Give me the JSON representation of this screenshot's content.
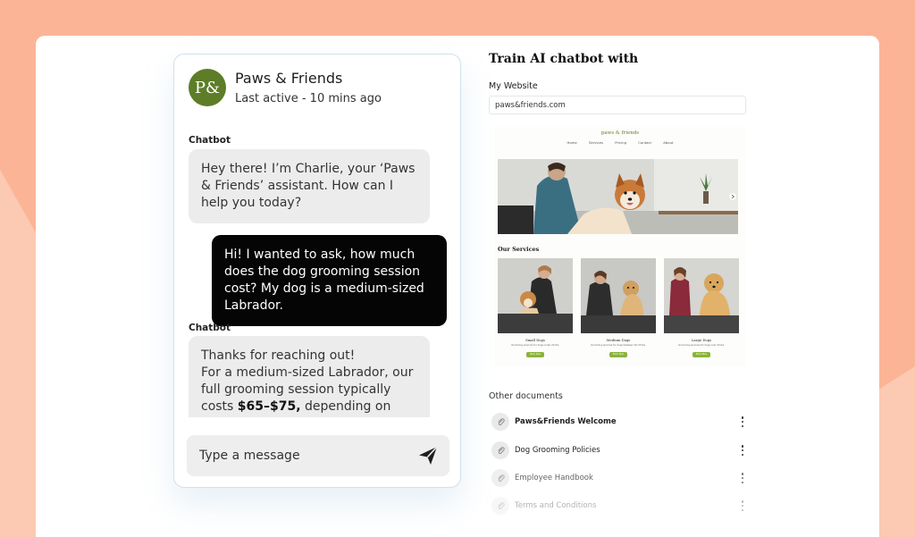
{
  "chat": {
    "avatar_text": "P&",
    "name": "Paws & Friends",
    "status": "Last active - 10 mins ago",
    "messages": [
      {
        "sender": "Chatbot",
        "text": "Hey there! I’m Charlie, your ‘Paws & Friends’ assistant. How can I help you today?"
      },
      {
        "sender": "",
        "text": "Hi! I wanted to ask, how much does the dog grooming session cost? My dog is a medium-sized Labrador."
      },
      {
        "sender": "Chatbot",
        "text_intro": "Thanks for reaching out!",
        "text_before": "For a medium-sized Labrador, our full grooming session typically costs ",
        "text_bold": "$65–$75,",
        "text_after": " depending on your pup's coat condition and any specific needs."
      }
    ],
    "composer_placeholder": "Type a message",
    "send_icon": "send-icon"
  },
  "train": {
    "title": "Train AI chatbot with",
    "website_label": "My Website",
    "website_value": "paws&friends.com",
    "preview": {
      "logo": "paws & friends",
      "nav": [
        "Home",
        "Services",
        "Pricing",
        "Contact",
        "About"
      ],
      "services_title": "Our Services",
      "services": [
        {
          "name": "Small Dogs",
          "desc": "Grooming services for dogs under 20 lbs.",
          "button": "Book Now"
        },
        {
          "name": "Medium Dogs",
          "desc": "Grooming services for dogs between 20–50 lbs.",
          "button": "Book Now"
        },
        {
          "name": "Large Dogs",
          "desc": "Grooming services for dogs over 50 lbs.",
          "button": "Book Now"
        }
      ]
    },
    "docs_label": "Other documents",
    "documents": [
      {
        "name": "Paws&Friends Welcome"
      },
      {
        "name": "Dog Grooming Policies"
      },
      {
        "name": "Employee Handbook"
      },
      {
        "name": "Terms and Conditions"
      }
    ]
  },
  "colors": {
    "background": "#fbb596",
    "brand_green": "#5d7d27",
    "user_bubble": "#050505",
    "bot_bubble": "#ececec"
  }
}
